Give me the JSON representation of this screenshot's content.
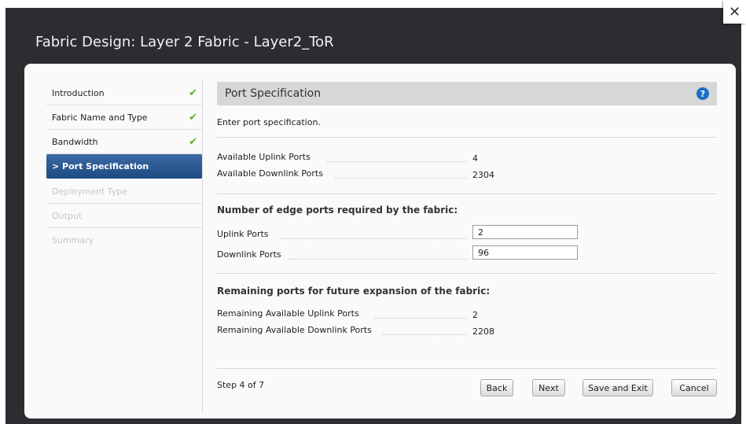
{
  "dialog": {
    "title": "Fabric Design: Layer 2 Fabric - Layer2_ToR",
    "close_label": "✕"
  },
  "sidebar": {
    "items": [
      {
        "label": "Introduction",
        "state": "complete"
      },
      {
        "label": "Fabric Name and Type",
        "state": "complete"
      },
      {
        "label": "Bandwidth",
        "state": "complete"
      },
      {
        "label": "> Port Specification",
        "state": "active"
      },
      {
        "label": "Deployment Type",
        "state": "disabled"
      },
      {
        "label": "Output",
        "state": "disabled"
      },
      {
        "label": "Summary",
        "state": "disabled"
      }
    ],
    "check_icon": "✔"
  },
  "main": {
    "header_title": "Port Specification",
    "help_label": "?",
    "description": "Enter port specification.",
    "available": {
      "uplink_label": "Available Uplink Ports",
      "uplink_value": "4",
      "downlink_label": "Available Downlink Ports",
      "downlink_value": "2304"
    },
    "required": {
      "heading": "Number of edge ports required by the fabric:",
      "uplink_label": "Uplink Ports",
      "uplink_value": "2",
      "downlink_label": "Downlink Ports",
      "downlink_value": "96"
    },
    "remaining": {
      "heading": "Remaining ports for future expansion of the fabric:",
      "uplink_label": "Remaining Available Uplink Ports",
      "uplink_value": "2",
      "downlink_label": "Remaining Available Downlink Ports",
      "downlink_value": "2208"
    }
  },
  "footer": {
    "step": "Step 4 of 7",
    "back": "Back",
    "next": "Next",
    "save_exit": "Save and Exit",
    "cancel": "Cancel"
  },
  "colors": {
    "active_item": "#2a5a94",
    "check": "#5cad32",
    "help": "#1b6fc7",
    "dialog_bg": "#2c2d31"
  }
}
